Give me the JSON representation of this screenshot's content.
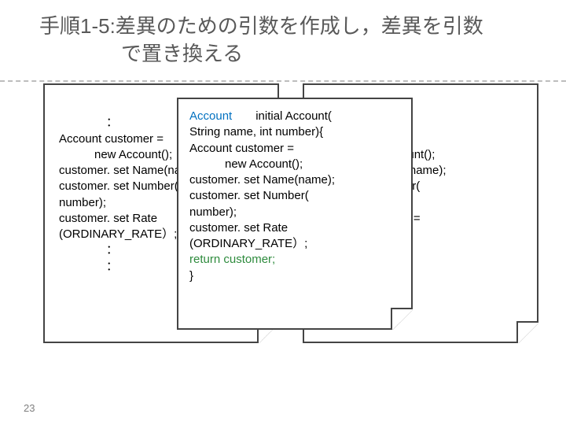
{
  "title": "手順1-5:差異のための引数を作成し，差異を引数\n　　　　で置き換える",
  "page_number": "23",
  "left_code": "\n　　　　：\nAccount customer =\n　　　new Account();\ncustomer. set Name(name);\ncustomer. set Number(\nnumber);\ncustomer. set Rate\n(ORDINARY_RATE）;\n　　　　：\n　　　　：",
  "right_code": "\n　　　　　　　：\n　　 customer =\n　　　 new Account();\n　　 r. set Name(name);\n　　 r. set Number(\n　　 ;\n　　 r. set Rate () =\n　　 RATE);\n　　　　　　　：\n　　　　　　　：",
  "front_code_parts": {
    "type_kw": "Account",
    "head": "　　initial Account(\nString name, int number){\nAccount customer =\n　　　new Account();\ncustomer. set Name(name);\ncustomer. set Number(\nnumber);\ncustomer. set Rate\n(ORDINARY_RATE）;\n",
    "return_kw": "return customer;",
    "tail": "\n}"
  }
}
